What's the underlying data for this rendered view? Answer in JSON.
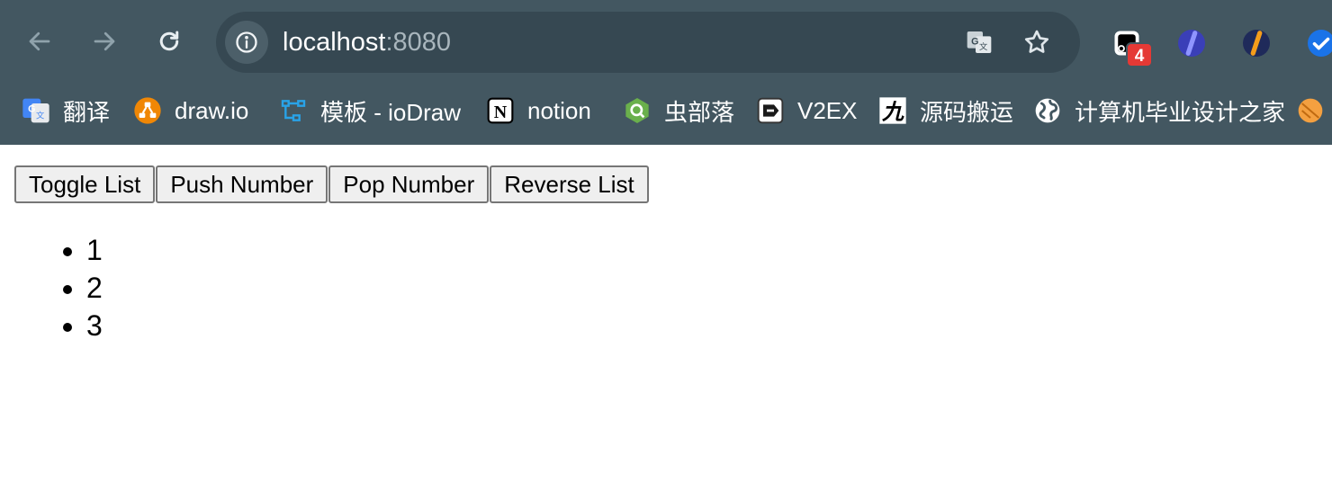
{
  "browser": {
    "url_host": "localhost",
    "url_port": ":8080",
    "extension_badge": "4",
    "bookmarks": [
      {
        "label": "翻译"
      },
      {
        "label": "draw.io"
      },
      {
        "label": "模板 - ioDraw"
      },
      {
        "label": "notion"
      },
      {
        "label": "虫部落"
      },
      {
        "label": "V2EX"
      },
      {
        "label": "源码搬运"
      },
      {
        "label": "计算机毕业设计之家"
      }
    ]
  },
  "page": {
    "buttons": {
      "toggle": "Toggle List",
      "push": "Push Number",
      "pop": "Pop Number",
      "reverse": "Reverse List"
    },
    "list_items": [
      "1",
      "2",
      "3"
    ]
  },
  "colors": {
    "chrome_bg": "#435761",
    "omnibox_bg": "#364852",
    "badge": "#e53935"
  }
}
